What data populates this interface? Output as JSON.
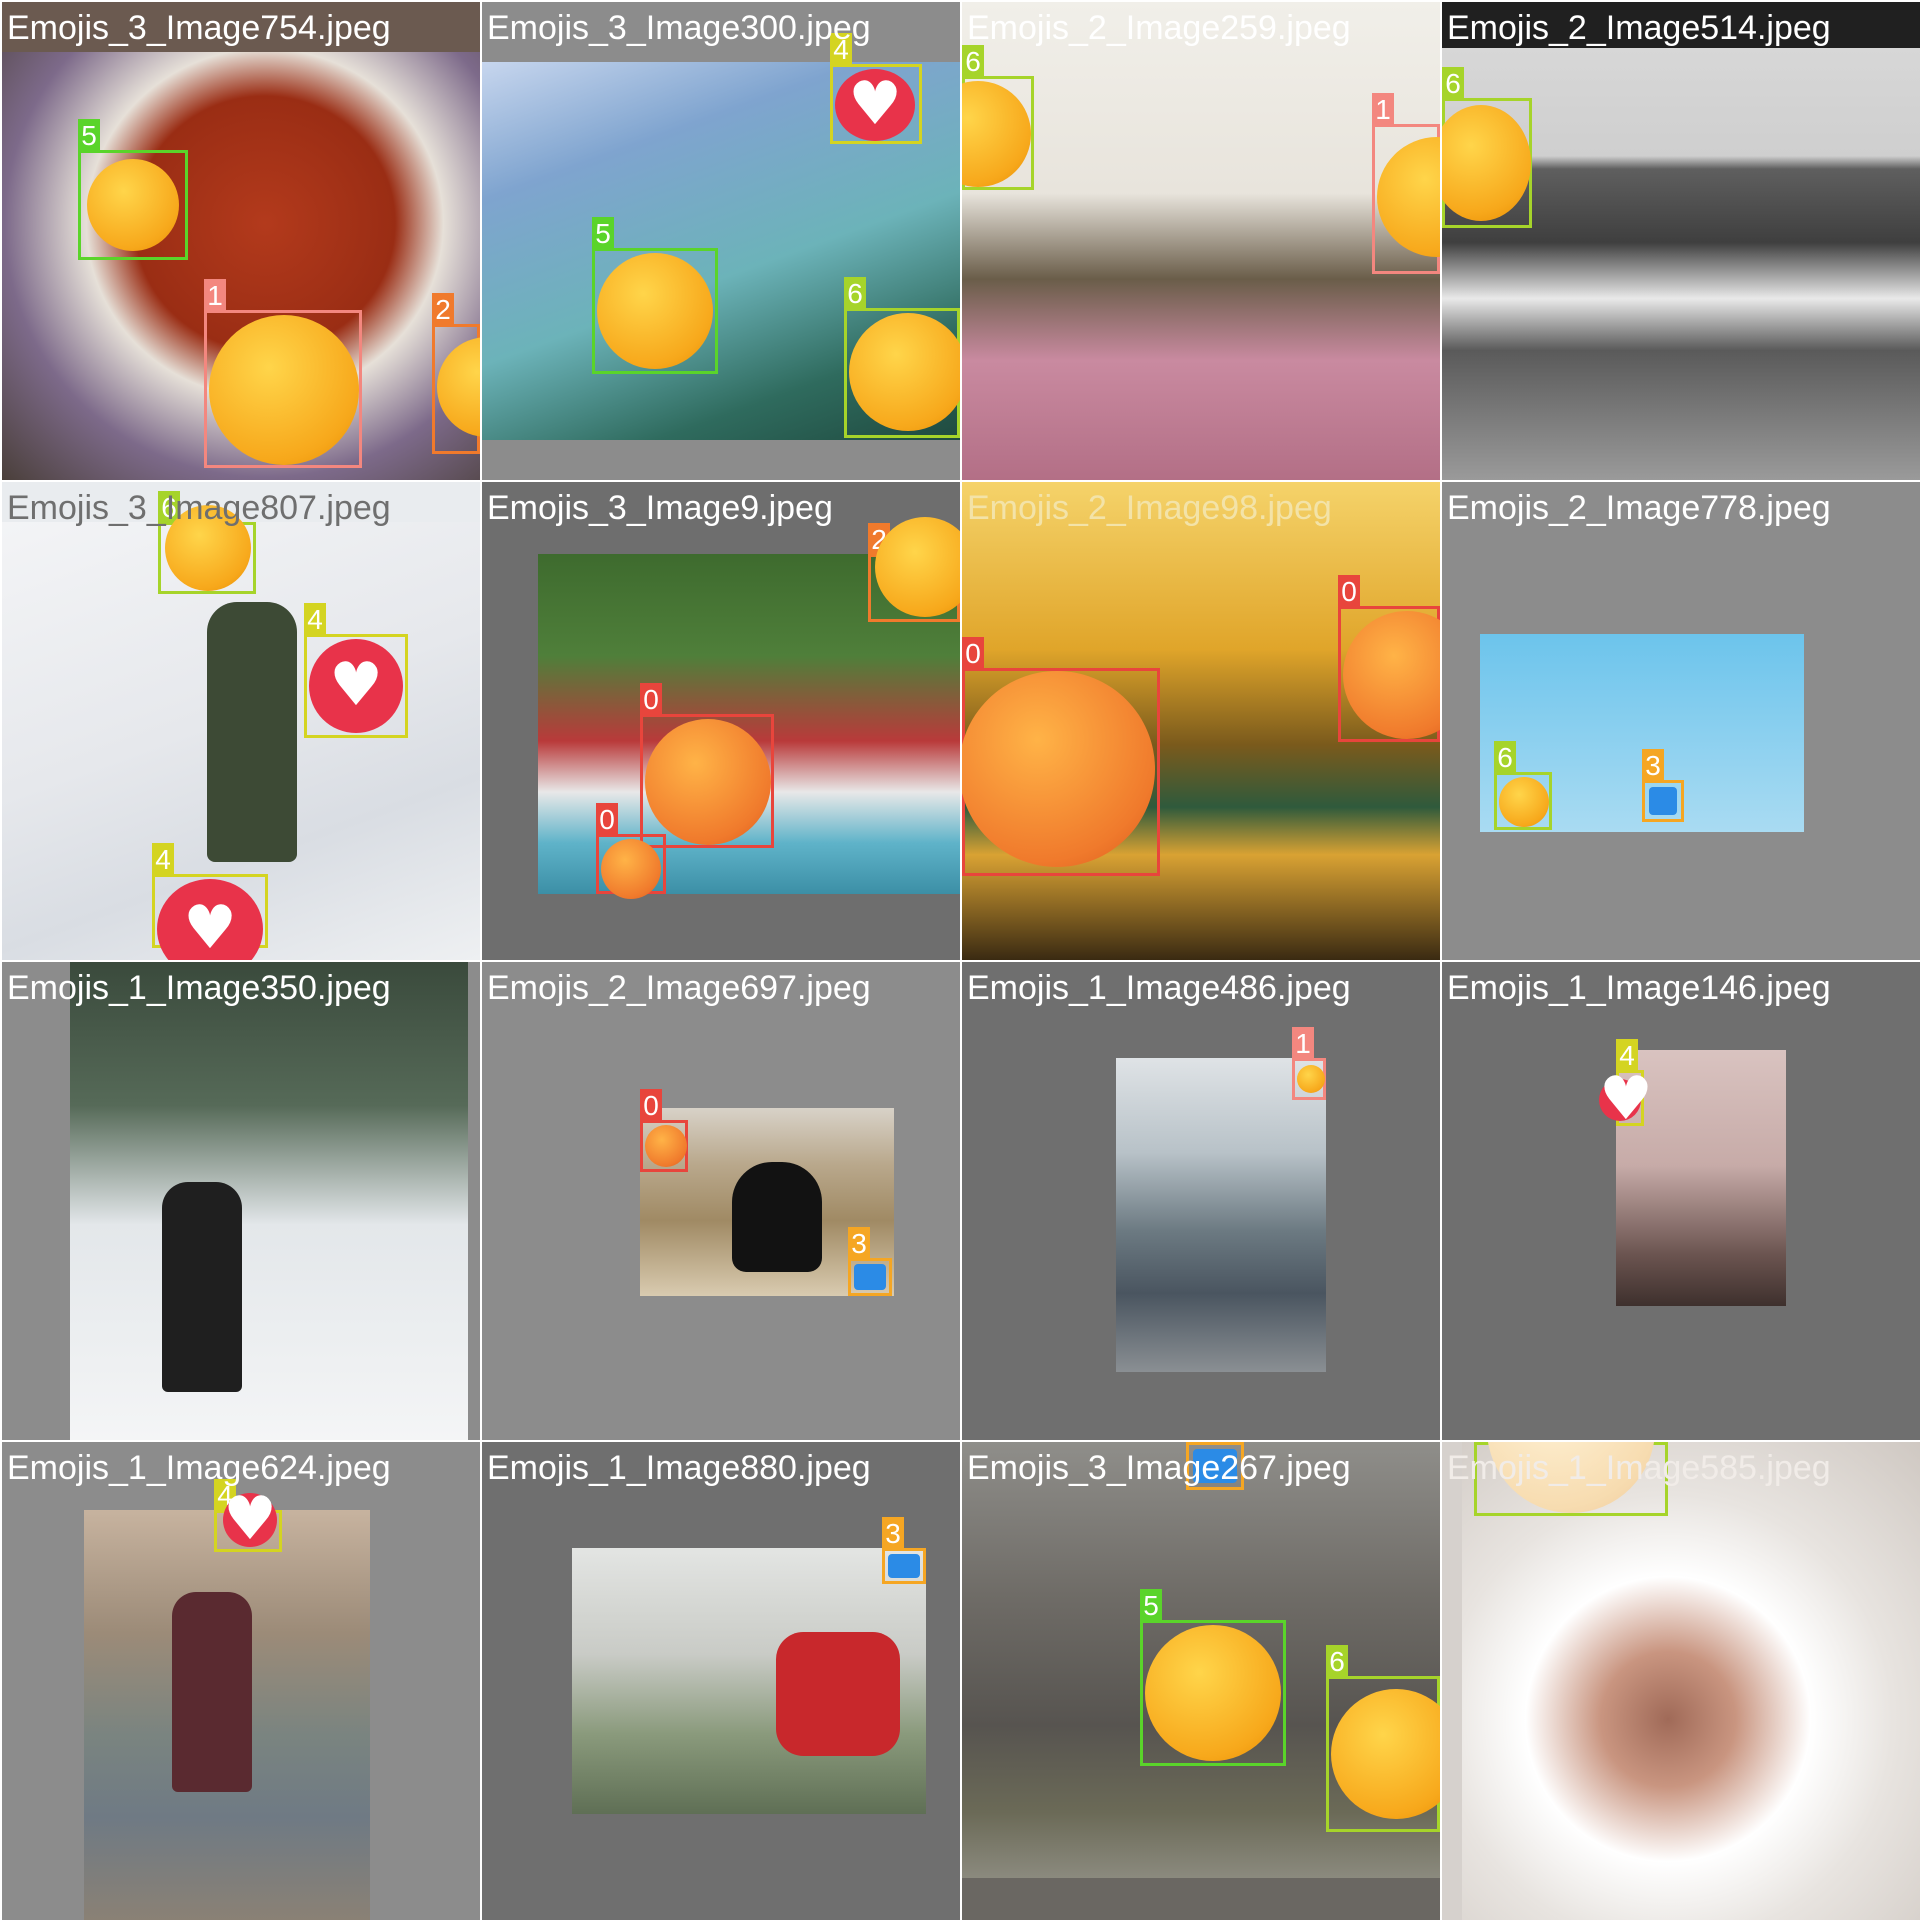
{
  "colors": {
    "class_0": "#e8453c",
    "class_1": "#f3877f",
    "class_2": "#f07a2c",
    "class_3": "#f5a623",
    "class_4": "#d4d421",
    "class_5": "#5ad42a",
    "class_6": "#a6d42a"
  },
  "tiles": [
    {
      "label": "Emojis_3_Image754.jpeg",
      "boxes": [
        "5",
        "1",
        "2"
      ]
    },
    {
      "label": "Emojis_3_Image300.jpeg",
      "boxes": [
        "4",
        "5",
        "6"
      ]
    },
    {
      "label": "Emojis_2_Image259.jpeg",
      "boxes": [
        "6",
        "1"
      ]
    },
    {
      "label": "Emojis_2_Image514.jpeg",
      "boxes": [
        "6"
      ]
    },
    {
      "label": "Emojis_3_Image807.jpeg",
      "boxes": [
        "6",
        "4",
        "4"
      ]
    },
    {
      "label": "Emojis_3_Image9.jpeg",
      "boxes": [
        "2",
        "0",
        "0"
      ]
    },
    {
      "label": "Emojis_2_Image98.jpeg",
      "boxes": [
        "0",
        "0"
      ]
    },
    {
      "label": "Emojis_2_Image778.jpeg",
      "boxes": [
        "6",
        "3"
      ]
    },
    {
      "label": "Emojis_1_Image350.jpeg",
      "boxes": []
    },
    {
      "label": "Emojis_2_Image697.jpeg",
      "boxes": [
        "0",
        "3"
      ]
    },
    {
      "label": "Emojis_1_Image486.jpeg",
      "boxes": [
        "1"
      ]
    },
    {
      "label": "Emojis_1_Image146.jpeg",
      "boxes": [
        "4"
      ]
    },
    {
      "label": "Emojis_1_Image624.jpeg",
      "boxes": [
        "4"
      ]
    },
    {
      "label": "Emojis_1_Image880.jpeg",
      "boxes": [
        "3"
      ]
    },
    {
      "label": "Emojis_3_Image267.jpeg",
      "boxes": [
        "3",
        "5",
        "6"
      ]
    },
    {
      "label": "Emojis_1_Image585.jpeg",
      "boxes": [
        "6"
      ]
    }
  ]
}
